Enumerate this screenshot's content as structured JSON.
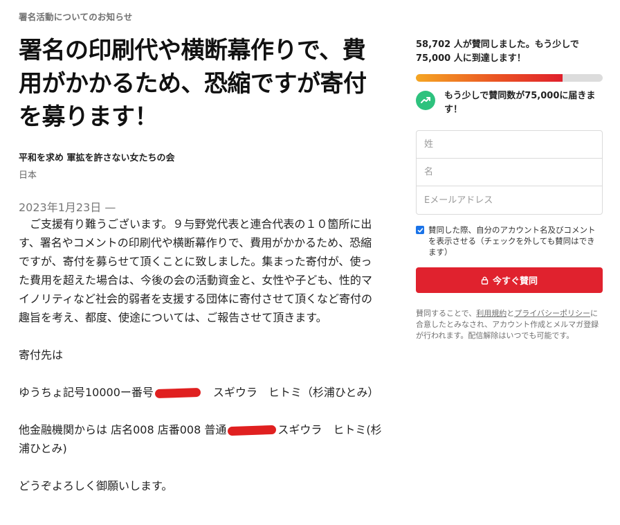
{
  "petition": {
    "overline": "署名活動についてのお知らせ",
    "title": "署名の印刷代や横断幕作りで、費用がかかるため、恐縮ですが寄付を募ります！",
    "organization": "平和を求め 軍拡を許さない女たちの会",
    "country": "日本",
    "date": "2023年1月23日 —"
  },
  "body": {
    "p1": "　ご支援有り難うございます。９与野党代表と連合代表の１０箇所に出す、署名やコメントの印刷代や横断幕作りで、費用がかかるため、恐縮ですが、寄付を募らせて頂くことに致しました。集まった寄付が、使った費用を超えた場合は、今後の会の活動資金と、女性や子ども、性的マイノリティなど社会的弱者を支援する団体に寄付させて頂くなど寄付の趣旨を考え、都度、使途については、ご報告させて頂きます。",
    "p2": "寄付先は",
    "p3_before": "ゆうちょ記号10000ー番号",
    "p3_after": "　スギウラ　ヒトミ（杉浦ひとみ）",
    "p4_before": "他金融機関からは 店名008 店番008 普通",
    "p4_after": "スギウラ　ヒトミ(杉浦ひとみ)",
    "p5": "どうぞよろしく御願いします。"
  },
  "sidebar": {
    "count": "58,702",
    "count_suffix": " 人が賛同しました。もう少しで 75,000 人に到達します！",
    "progress": 0.787,
    "nudge": "もう少しで賛同数が75,000に届きます！",
    "first_name_placeholder": "姓",
    "last_name_placeholder": "名",
    "email_placeholder": "Eメールアドレス",
    "consent_label": "賛同した際、自分のアカウント名及びコメントを表示させる（チェックを外しても賛同はできます）",
    "consent_checked": true,
    "sign_button": "今すぐ賛同",
    "legal_prefix": "賛同することで、",
    "terms_link": "利用規約",
    "legal_and": "と",
    "privacy_link": "プライバシーポリシー",
    "legal_suffix": "に合意したとみなされ、アカウント作成とメルマガ登録が行われます。配信解除はいつでも可能です。",
    "accent_color": "#e0222e",
    "trend_color": "#2ec27e"
  }
}
